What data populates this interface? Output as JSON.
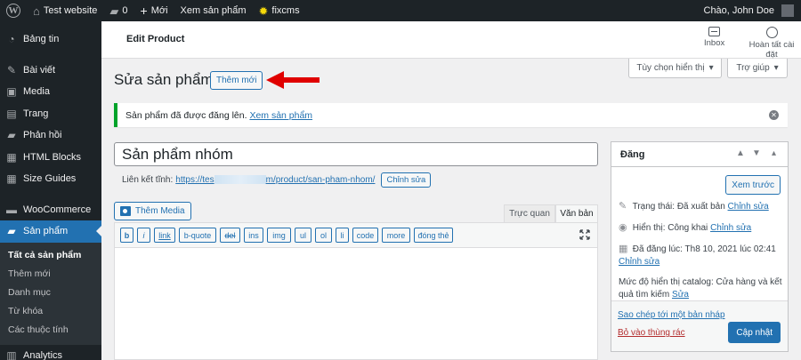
{
  "admin_bar": {
    "site_name": "Test website",
    "comments_count": "0",
    "new_label": "Mới",
    "view_product": "Xem sản phẩm",
    "plugin_label": "fixcms",
    "greeting": "Chào, John Doe"
  },
  "sidebar": {
    "items": [
      {
        "label": "Bảng tin",
        "icon": "dashboard-icon"
      },
      {
        "label": "Bài viết",
        "icon": "pin-icon"
      },
      {
        "label": "Media",
        "icon": "media-icon"
      },
      {
        "label": "Trang",
        "icon": "page-icon"
      },
      {
        "label": "Phản hồi",
        "icon": "comment-icon"
      },
      {
        "label": "HTML Blocks",
        "icon": "html-block-icon"
      },
      {
        "label": "Size Guides",
        "icon": "size-guide-icon"
      },
      {
        "label": "WooCommerce",
        "icon": "woo-icon"
      },
      {
        "label": "Sản phẩm",
        "icon": "product-icon"
      }
    ],
    "submenu": [
      "Tất cả sản phẩm",
      "Thêm mới",
      "Danh mục",
      "Từ khóa",
      "Các thuộc tính"
    ],
    "analytics": "Analytics"
  },
  "header": {
    "title": "Edit Product",
    "inbox": "Inbox",
    "finish_setup": "Hoàn tất cài đặt"
  },
  "screen_options": {
    "display_options": "Tùy chọn hiển thị",
    "help": "Trợ giúp"
  },
  "page": {
    "title": "Sửa sản phẩm",
    "add_new": "Thêm mới"
  },
  "notice": {
    "text": "Sản phẩm đã được đăng lên.",
    "link": "Xem sản phẩm"
  },
  "product": {
    "title": "Sản phẩm nhóm",
    "permalink_label": "Liên kết tĩnh:",
    "permalink_start": "https://tes",
    "permalink_end": "m/product/san-pham-nhom/",
    "edit_permalink": "Chỉnh sửa"
  },
  "editor": {
    "add_media": "Thêm Media",
    "tab_visual": "Trực quan",
    "tab_text": "Văn bản",
    "quicktags": [
      "b",
      "i",
      "link",
      "b-quote",
      "del",
      "ins",
      "img",
      "ul",
      "ol",
      "li",
      "code",
      "more",
      "đóng thẻ"
    ]
  },
  "publish": {
    "title": "Đăng",
    "preview": "Xem trước",
    "status_label": "Trạng thái:",
    "status_value": "Đã xuất bản",
    "status_edit": "Chỉnh sửa",
    "visibility_label": "Hiển thị:",
    "visibility_value": "Công khai",
    "visibility_edit": "Chỉnh sửa",
    "published_label": "Đã đăng lúc:",
    "published_value": "Th8 10, 2021 lúc 02:41",
    "published_edit": "Chỉnh sửa",
    "catalog_label": "Mức độ hiển thị catalog:",
    "catalog_value": "Cửa hàng và kết quả tìm kiếm",
    "catalog_edit": "Sửa",
    "copy_draft": "Sao chép tới một bản nháp",
    "trash": "Bỏ vào thùng rác",
    "update": "Cập nhật"
  },
  "colors": {
    "admin_dark": "#1d2327",
    "accent": "#2271b1",
    "success": "#00a32a",
    "danger": "#b32d2e",
    "arrow": "#e00000"
  }
}
